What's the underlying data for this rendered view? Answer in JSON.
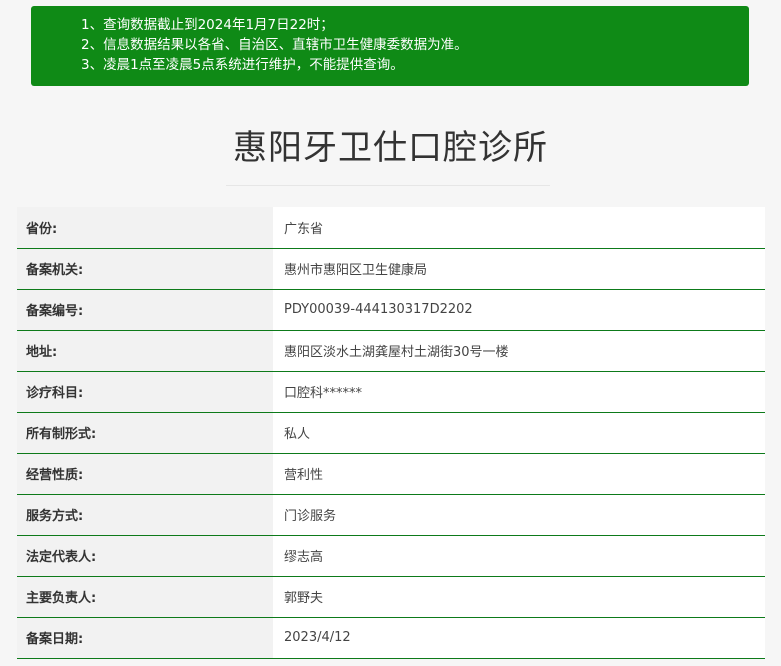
{
  "notice": {
    "lines": [
      "1、查询数据截止到2024年1月7日22时；",
      "2、信息数据结果以各省、自治区、直辖市卫生健康委数据为准。",
      "3、凌晨1点至凌晨5点系统进行维护，不能提供查询。"
    ],
    "background_color": "#0f8a16"
  },
  "clinic": {
    "name": "惠阳牙卫仕口腔诊所"
  },
  "details": [
    {
      "label": "省份:",
      "value": "广东省"
    },
    {
      "label": "备案机关:",
      "value": "惠州市惠阳区卫生健康局"
    },
    {
      "label": "备案编号:",
      "value": "PDY00039-444130317D2202"
    },
    {
      "label": "地址:",
      "value": "惠阳区淡水土湖龚屋村土湖街30号一楼"
    },
    {
      "label": "诊疗科目:",
      "value": "口腔科******"
    },
    {
      "label": "所有制形式:",
      "value": "私人"
    },
    {
      "label": "经营性质:",
      "value": "营利性"
    },
    {
      "label": "服务方式:",
      "value": "门诊服务"
    },
    {
      "label": "法定代表人:",
      "value": "缪志高"
    },
    {
      "label": "主要负责人:",
      "value": "郭野夫"
    },
    {
      "label": "备案日期:",
      "value": "2023/4/12"
    }
  ],
  "colors": {
    "row_divider": "#0d7a1a",
    "label_background": "#f2f2f2",
    "value_background": "#ffffff"
  }
}
